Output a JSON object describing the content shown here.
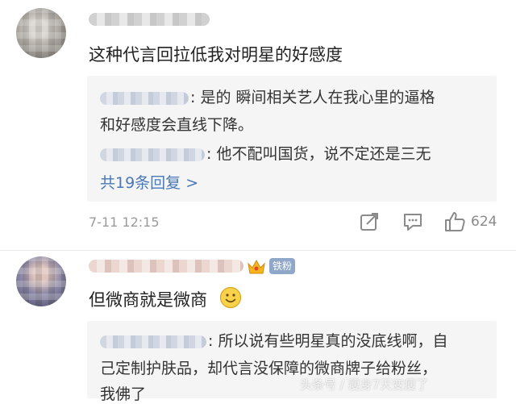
{
  "comments": [
    {
      "text": "这种代言回拉低我对明星的好感度",
      "replies": [
        {
          "line1": ": 是的   瞬间相关艺人在我心里的逼格",
          "line2": "和好感度会直线下降。"
        },
        {
          "line1": ": 他不配叫国货，说不定还是三无"
        }
      ],
      "more_replies": "共19条回复 >",
      "timestamp": "7-11 12:15",
      "like_count": "624"
    },
    {
      "fan_badge": "铁粉",
      "text": "但微商就是微商",
      "replies": [
        {
          "line1": ": 所以说有些明星真的没底线啊，自",
          "line2": "己定制护肤品，却代言没保障的微商牌子给粉丝，",
          "line3": "我佛了"
        }
      ]
    }
  ],
  "watermark": "头条号 / 瘦身7天变瘦了",
  "icons": [
    "share-icon",
    "comment-icon",
    "like-icon",
    "crown-icon",
    "smiley-emoji-icon"
  ],
  "colors": {
    "link": "#4a77b6",
    "reply_bg": "#f5f5f5",
    "meta": "#9a9a9a",
    "badge": "#8fa7c9"
  }
}
